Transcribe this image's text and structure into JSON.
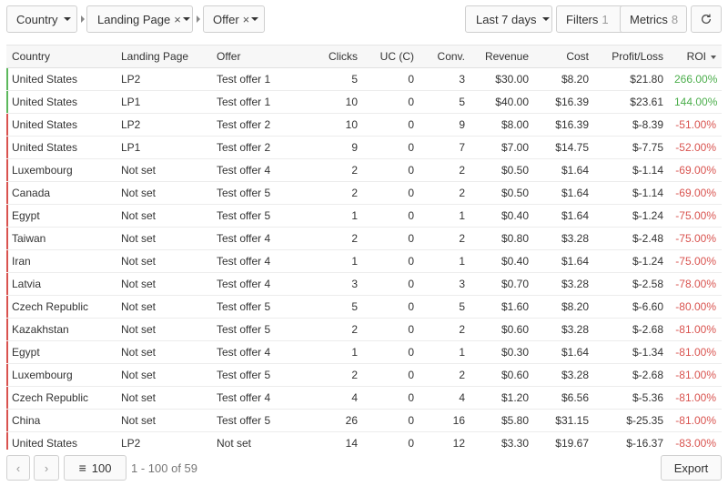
{
  "toolbar": {
    "filters_chips": [
      {
        "label": "Country",
        "removable": false
      },
      {
        "label": "Landing Page",
        "removable": true
      },
      {
        "label": "Offer",
        "removable": true
      }
    ],
    "date_range": "Last 7 days",
    "filters_label": "Filters",
    "filters_count": "1",
    "metrics_label": "Metrics",
    "metrics_count": "8",
    "refresh_icon": "refresh-icon",
    "remove_glyph": "×"
  },
  "table": {
    "columns": [
      "Country",
      "Landing Page",
      "Offer",
      "Clicks",
      "UC (C)",
      "Conv.",
      "Revenue",
      "Cost",
      "Profit/Loss",
      "ROI"
    ],
    "rows": [
      [
        "United States",
        "LP2",
        "Test offer 1",
        "5",
        "0",
        "3",
        "$30.00",
        "$8.20",
        "$21.80",
        "266.00%"
      ],
      [
        "United States",
        "LP1",
        "Test offer 1",
        "10",
        "0",
        "5",
        "$40.00",
        "$16.39",
        "$23.61",
        "144.00%"
      ],
      [
        "United States",
        "LP2",
        "Test offer 2",
        "10",
        "0",
        "9",
        "$8.00",
        "$16.39",
        "$-8.39",
        "-51.00%"
      ],
      [
        "United States",
        "LP1",
        "Test offer 2",
        "9",
        "0",
        "7",
        "$7.00",
        "$14.75",
        "$-7.75",
        "-52.00%"
      ],
      [
        "Luxembourg",
        "Not set",
        "Test offer 4",
        "2",
        "0",
        "2",
        "$0.50",
        "$1.64",
        "$-1.14",
        "-69.00%"
      ],
      [
        "Canada",
        "Not set",
        "Test offer 5",
        "2",
        "0",
        "2",
        "$0.50",
        "$1.64",
        "$-1.14",
        "-69.00%"
      ],
      [
        "Egypt",
        "Not set",
        "Test offer 5",
        "1",
        "0",
        "1",
        "$0.40",
        "$1.64",
        "$-1.24",
        "-75.00%"
      ],
      [
        "Taiwan",
        "Not set",
        "Test offer 4",
        "2",
        "0",
        "2",
        "$0.80",
        "$3.28",
        "$-2.48",
        "-75.00%"
      ],
      [
        "Iran",
        "Not set",
        "Test offer 4",
        "1",
        "0",
        "1",
        "$0.40",
        "$1.64",
        "$-1.24",
        "-75.00%"
      ],
      [
        "Latvia",
        "Not set",
        "Test offer 4",
        "3",
        "0",
        "3",
        "$0.70",
        "$3.28",
        "$-2.58",
        "-78.00%"
      ],
      [
        "Czech Republic",
        "Not set",
        "Test offer 5",
        "5",
        "0",
        "5",
        "$1.60",
        "$8.20",
        "$-6.60",
        "-80.00%"
      ],
      [
        "Kazakhstan",
        "Not set",
        "Test offer 5",
        "2",
        "0",
        "2",
        "$0.60",
        "$3.28",
        "$-2.68",
        "-81.00%"
      ],
      [
        "Egypt",
        "Not set",
        "Test offer 4",
        "1",
        "0",
        "1",
        "$0.30",
        "$1.64",
        "$-1.34",
        "-81.00%"
      ],
      [
        "Luxembourg",
        "Not set",
        "Test offer 5",
        "2",
        "0",
        "2",
        "$0.60",
        "$3.28",
        "$-2.68",
        "-81.00%"
      ],
      [
        "Czech Republic",
        "Not set",
        "Test offer 4",
        "4",
        "0",
        "4",
        "$1.20",
        "$6.56",
        "$-5.36",
        "-81.00%"
      ],
      [
        "China",
        "Not set",
        "Test offer 5",
        "26",
        "0",
        "16",
        "$5.80",
        "$31.15",
        "$-25.35",
        "-81.00%"
      ],
      [
        "United States",
        "LP2",
        "Not set",
        "14",
        "0",
        "12",
        "$3.30",
        "$19.67",
        "$-16.37",
        "-83.00%"
      ]
    ]
  },
  "footer": {
    "prev_icon": "chevron-left-icon",
    "next_icon": "chevron-right-icon",
    "page_size": "100",
    "range_text": "1 - 100 of 59",
    "export_label": "Export"
  },
  "colors": {
    "positive": "#4cae4c",
    "negative": "#d9534f"
  }
}
